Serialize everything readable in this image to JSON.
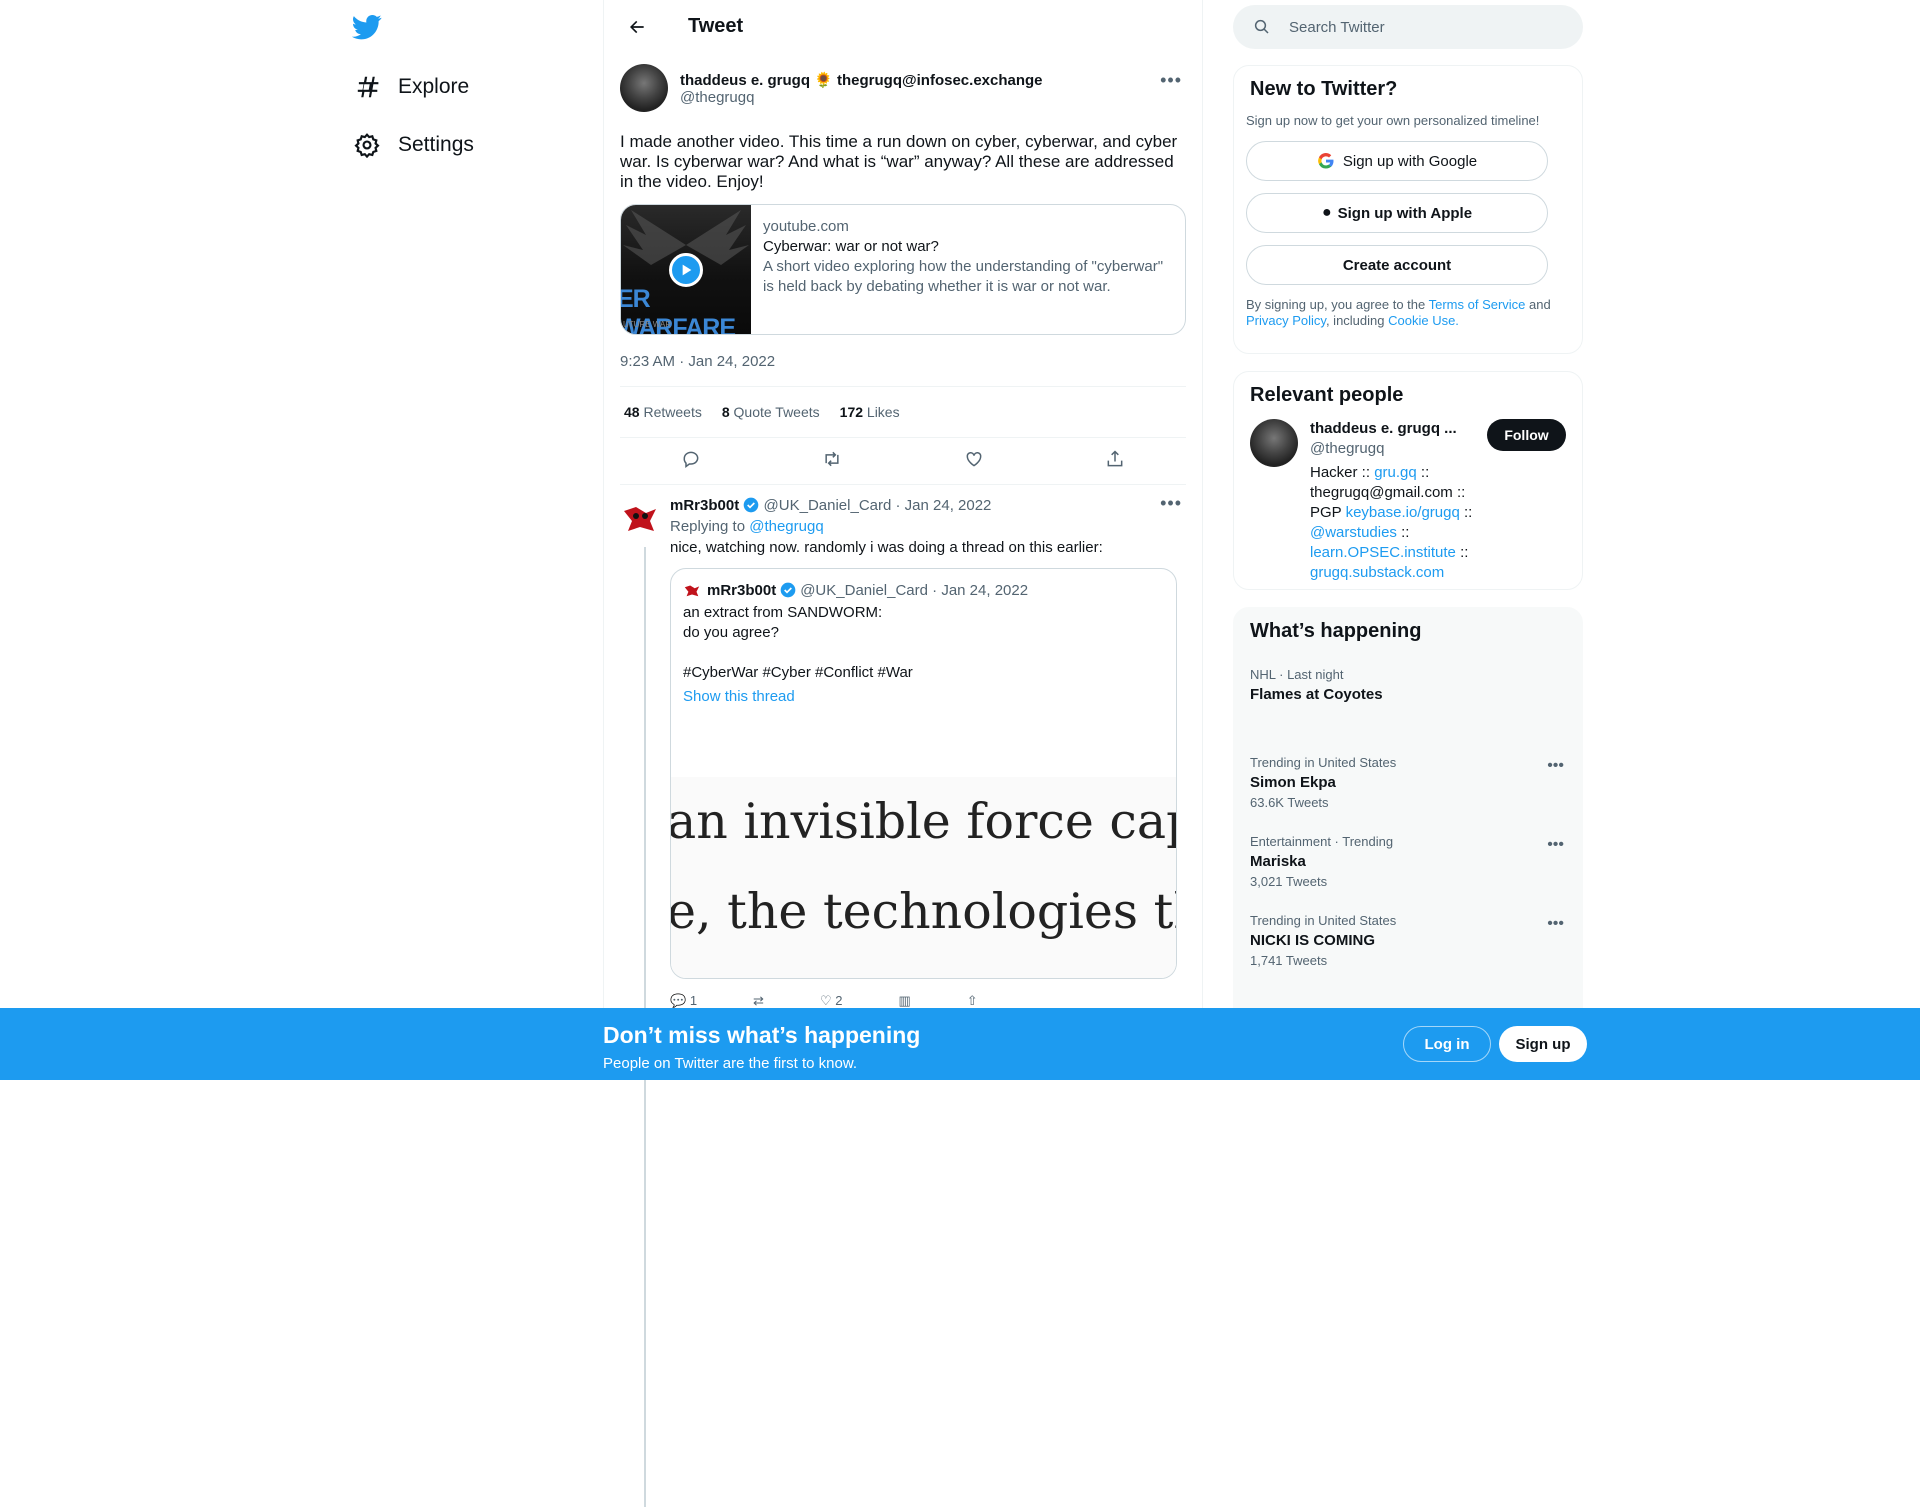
{
  "nav": {
    "explore": "Explore",
    "settings": "Settings"
  },
  "header": {
    "title": "Tweet"
  },
  "tweet": {
    "author_name": "thaddeus e. grugq 🌻 thegrugq@infosec.exchange",
    "author_handle": "@thegrugq",
    "text": "I made another video. This time a run down on cyber, cyberwar, and cyber war. Is cyberwar war? And what is “war” anyway? All these are addressed in the video. Enjoy!",
    "card": {
      "domain": "youtube.com",
      "title": "Cyberwar: war or not war?",
      "description": "A short video exploring how the understanding of \"cyberwar\" is held back by debating whether it is war or not war.",
      "thumb_text": "ER WARFARE",
      "thumb_sub": "UTURE WAR"
    },
    "timestamp": "9:23 AM · Jan 24, 2022",
    "retweets_count": "48",
    "retweets_label": "Retweets",
    "quotes_count": "8",
    "quotes_label": "Quote Tweets",
    "likes_count": "172",
    "likes_label": "Likes"
  },
  "reply": {
    "name": "mRr3b00t",
    "handle_date": "@UK_Daniel_Card · Jan 24, 2022",
    "replying_prefix": "Replying to ",
    "replying_to": "@thegrugq",
    "text": "nice, watching now. randomly i was doing a thread on this earlier:",
    "quote": {
      "name": "mRr3b00t",
      "handle_date": "@UK_Daniel_Card · Jan 24, 2022",
      "line1": "an extract from SANDWORM:",
      "line2": "do you agree?",
      "hashtags": "#CyberWar #Cyber #Conflict #War",
      "show_thread": "Show this thread",
      "image_line1": "an invisible force cap",
      "image_line2": "e, the technologies th"
    },
    "reply_count": "1",
    "like_count": "2"
  },
  "search": {
    "placeholder": "Search Twitter"
  },
  "new_to_twitter": {
    "title": "New to Twitter?",
    "subtitle": "Sign up now to get your own personalized timeline!",
    "google": "Sign up with Google",
    "apple": "Sign up with Apple",
    "create": "Create account",
    "legal_1": "By signing up, you agree to the ",
    "tos": "Terms of Service",
    "legal_2": " and ",
    "privacy": "Privacy Policy",
    "legal_3": ", including ",
    "cookie": "Cookie Use."
  },
  "relevant": {
    "title": "Relevant people",
    "name": "thaddeus e. grugq ...",
    "handle": "@thegrugq",
    "follow": "Follow",
    "bio_1": "Hacker :: ",
    "bio_link1": "gru.gq",
    "bio_2": " :: thegrugq@gmail.com :: PGP ",
    "bio_link2": "keybase.io/grugq",
    "bio_3": " :: ",
    "bio_link3": "@warstudies",
    "bio_4": " :: ",
    "bio_link4": "learn.OPSEC.institute",
    "bio_5": " :: ",
    "bio_link5": "grugq.substack.com"
  },
  "happening": {
    "title": "What’s happening",
    "trends": [
      {
        "context": "NHL · Last night",
        "name": "Flames at Coyotes",
        "count": ""
      },
      {
        "context": "Trending in United States",
        "name": "Simon Ekpa",
        "count": "63.6K Tweets"
      },
      {
        "context": "Entertainment · Trending",
        "name": "Mariska",
        "count": "3,021 Tweets"
      },
      {
        "context": "Trending in United States",
        "name": "NICKI IS COMING",
        "count": "1,741 Tweets"
      }
    ]
  },
  "bottom_bar": {
    "title": "Don’t miss what’s happening",
    "subtitle": "People on Twitter are the first to know.",
    "login": "Log in",
    "signup": "Sign up"
  },
  "colors": {
    "accent": "#1d9bf0",
    "text": "#0f1419",
    "muted": "#536471"
  }
}
